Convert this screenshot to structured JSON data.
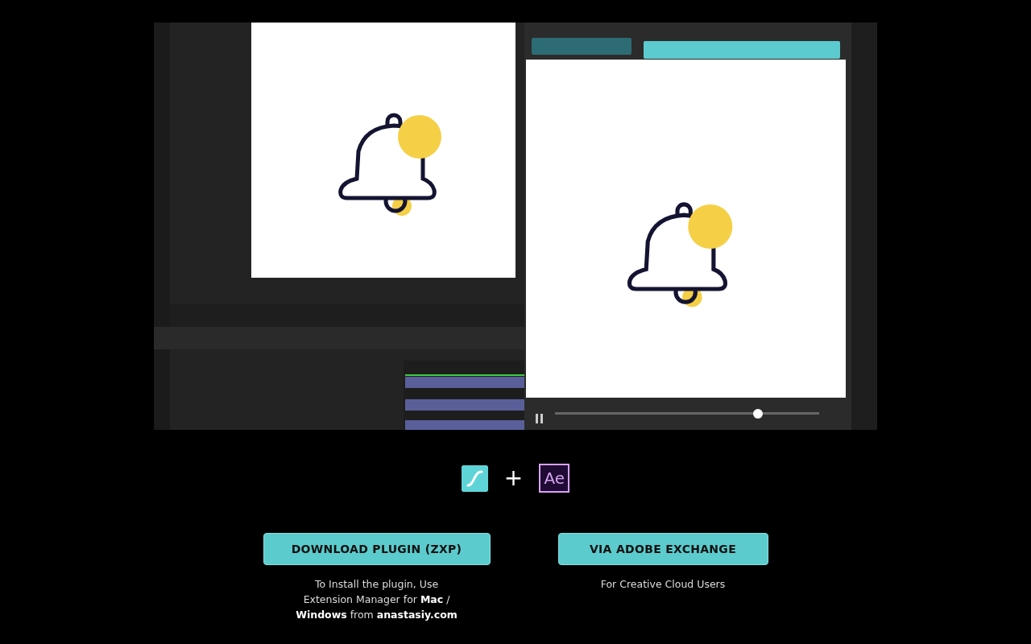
{
  "logos": {
    "plus": "+",
    "ae_label": "Ae"
  },
  "actions": [
    {
      "label": "DOWNLOAD PLUGIN (ZXP)",
      "note": "To Install the plugin, Use Extension Manager for **Mac** / **Windows** from **anastasiy.com**"
    },
    {
      "label": "VIA ADOBE EXCHANGE",
      "note": "For Creative Cloud Users"
    }
  ]
}
